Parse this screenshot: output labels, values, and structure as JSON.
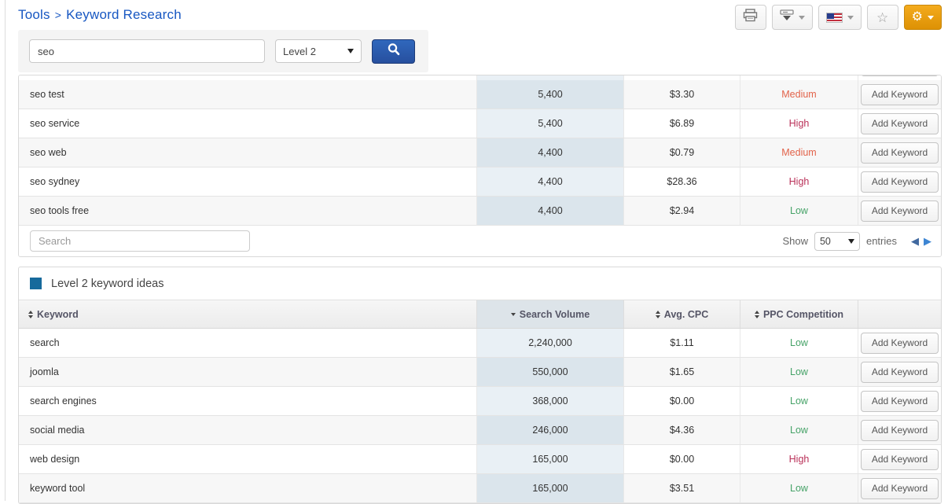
{
  "breadcrumb": {
    "section": "Tools",
    "separator": ">",
    "page": "Keyword Research"
  },
  "toolbar": {
    "buttons": [
      {
        "name": "print",
        "icon": "printer-icon"
      },
      {
        "name": "export",
        "icon": "download-icon",
        "has_caret": true
      },
      {
        "name": "language",
        "icon": "us-flag-icon",
        "has_caret": true
      },
      {
        "name": "favorite",
        "icon": "star-icon",
        "glyph": "☆"
      },
      {
        "name": "settings",
        "icon": "gear-icon",
        "glyph": "⚙",
        "has_caret": true,
        "color": "#e89c0e"
      }
    ]
  },
  "search_bar": {
    "keyword_value": "seo",
    "level_selected": "Level 2",
    "search_button_icon": "magnifier-icon",
    "search_button_color": "#2c5fae"
  },
  "columns": {
    "keyword": "Keyword",
    "volume": "Search Volume",
    "cpc": "Avg. CPC",
    "competition": "PPC Competition",
    "volume_sort": "desc"
  },
  "add_keyword_label": "Add Keyword",
  "results_table": {
    "rows": [
      {
        "keyword": "seo test",
        "volume": "5,400",
        "cpc": "$3.30",
        "competition": "Medium"
      },
      {
        "keyword": "seo service",
        "volume": "5,400",
        "cpc": "$6.89",
        "competition": "High"
      },
      {
        "keyword": "seo web",
        "volume": "4,400",
        "cpc": "$0.79",
        "competition": "Medium"
      },
      {
        "keyword": "seo sydney",
        "volume": "4,400",
        "cpc": "$28.36",
        "competition": "High"
      },
      {
        "keyword": "seo tools free",
        "volume": "4,400",
        "cpc": "$2.94",
        "competition": "Low"
      }
    ],
    "footer": {
      "search_placeholder": "Search",
      "show_label": "Show",
      "page_size": "50",
      "entries_label": "entries",
      "prev_icon": "◀",
      "next_icon": "▶"
    }
  },
  "ideas_table": {
    "title": "Level 2 keyword ideas",
    "rows": [
      {
        "keyword": "search",
        "volume": "2,240,000",
        "cpc": "$1.11",
        "competition": "Low"
      },
      {
        "keyword": "joomla",
        "volume": "550,000",
        "cpc": "$1.65",
        "competition": "Low"
      },
      {
        "keyword": "search engines",
        "volume": "368,000",
        "cpc": "$0.00",
        "competition": "Low"
      },
      {
        "keyword": "social media",
        "volume": "246,000",
        "cpc": "$4.36",
        "competition": "Low"
      },
      {
        "keyword": "web design",
        "volume": "165,000",
        "cpc": "$0.00",
        "competition": "High"
      },
      {
        "keyword": "keyword tool",
        "volume": "165,000",
        "cpc": "$3.51",
        "competition": "Low"
      }
    ]
  },
  "colors": {
    "breadcrumb_blue": "#1757c2",
    "competition_low": "#45a267",
    "competition_medium": "#e2634a",
    "competition_high": "#b93058",
    "volume_cell_light": "#e9f0f5",
    "volume_cell_dark": "#dbe5ec",
    "title_square_blue": "#176a9c"
  }
}
